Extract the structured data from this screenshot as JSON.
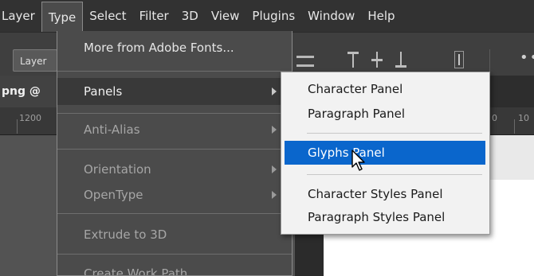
{
  "menubar": {
    "items": [
      "Layer",
      "Type",
      "Select",
      "Filter",
      "3D",
      "View",
      "Plugins",
      "Window",
      "Help"
    ],
    "active_index": 1
  },
  "options_bar": {
    "layer_button_label": "Layer",
    "more_icon": "ellipsis-icon"
  },
  "document": {
    "tab_label": "png @",
    "ruler_labels": [
      "1200",
      "0",
      "10"
    ]
  },
  "type_menu": {
    "items": [
      {
        "label": "More from Adobe Fonts...",
        "enabled": true
      },
      {
        "label": "Panels",
        "enabled": true,
        "submenu": true,
        "highlighted": true
      },
      {
        "label": "Anti-Alias",
        "enabled": false,
        "submenu": true
      },
      {
        "label": "Orientation",
        "enabled": false,
        "submenu": true
      },
      {
        "label": "OpenType",
        "enabled": false,
        "submenu": true
      },
      {
        "label": "Extrude to 3D",
        "enabled": false
      },
      {
        "label": "Create Work Path",
        "enabled": false
      }
    ]
  },
  "panels_submenu": {
    "items": [
      {
        "label": "Character Panel"
      },
      {
        "label": "Paragraph Panel"
      },
      {
        "label": "Glyphs Panel",
        "highlighted": true
      },
      {
        "label": "Character Styles Panel"
      },
      {
        "label": "Paragraph Styles Panel"
      }
    ]
  },
  "colors": {
    "highlight": "#0a66cc",
    "menubar": "#323232",
    "menu_bg": "#4b4b4b"
  }
}
